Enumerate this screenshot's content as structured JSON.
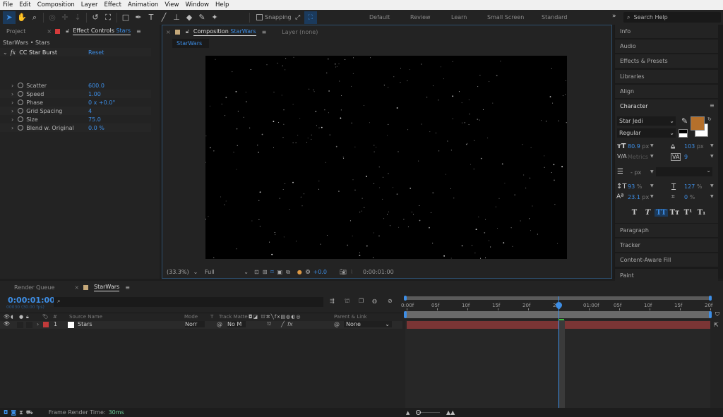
{
  "menu": [
    "File",
    "Edit",
    "Composition",
    "Layer",
    "Effect",
    "Animation",
    "View",
    "Window",
    "Help"
  ],
  "toolbar": {
    "tools": [
      {
        "name": "selection-tool-icon",
        "glyph": "➤",
        "active": true
      },
      {
        "name": "hand-tool-icon",
        "glyph": "✋"
      },
      {
        "name": "zoom-tool-icon",
        "glyph": "⌕"
      },
      {
        "name": "orbit-camera-icon",
        "glyph": "◎",
        "dim": true
      },
      {
        "name": "pan-camera-icon",
        "glyph": "✛",
        "dim": true
      },
      {
        "name": "dolly-camera-icon",
        "glyph": "⇣",
        "dim": true
      },
      {
        "name": "rotation-tool-icon",
        "glyph": "↺"
      },
      {
        "name": "pan-behind-tool-icon",
        "glyph": "⛶"
      },
      {
        "name": "rectangle-tool-icon",
        "glyph": "□"
      },
      {
        "name": "pen-tool-icon",
        "glyph": "✒"
      },
      {
        "name": "type-tool-icon",
        "glyph": "T"
      },
      {
        "name": "brush-tool-icon",
        "glyph": "╱"
      },
      {
        "name": "clone-stamp-tool-icon",
        "glyph": "⊥"
      },
      {
        "name": "eraser-tool-icon",
        "glyph": "◆"
      },
      {
        "name": "roto-brush-tool-icon",
        "glyph": "✎"
      },
      {
        "name": "puppet-pin-tool-icon",
        "glyph": "✦"
      }
    ],
    "snapping_label": "Snapping",
    "workspaces": [
      "Default",
      "Review",
      "Learn",
      "Small Screen",
      "Standard"
    ],
    "search_placeholder": "Search Help"
  },
  "effect_controls": {
    "project_tab": "Project",
    "tab_label": "Effect Controls",
    "tab_target": "Stars",
    "breadcrumb": "StarWars • Stars",
    "effect_name": "CC Star Burst",
    "reset_label": "Reset",
    "params": [
      {
        "label": "Scatter",
        "value": "600.0"
      },
      {
        "label": "Speed",
        "value": "1.00"
      },
      {
        "label": "Phase",
        "value": "0 x +0.0°"
      },
      {
        "label": "Grid Spacing",
        "value": "4"
      },
      {
        "label": "Size",
        "value": "75.0"
      },
      {
        "label": "Blend w. Original",
        "value": "0.0 %"
      }
    ]
  },
  "composition": {
    "tab_label": "Composition",
    "tab_target": "StarWars",
    "layer_tab": "Layer  (none)",
    "subtab": "StarWars",
    "zoom": "(33.3%)",
    "resolution": "Full",
    "exposure": "+0.0",
    "timecode": "0:00:01:00"
  },
  "right_panels": {
    "top": [
      "Info",
      "Audio",
      "Effects & Presets",
      "Libraries",
      "Align"
    ],
    "character_title": "Character",
    "font_family": "Star Jedi",
    "font_style": "Regular",
    "fill_color": "#b5702b",
    "font_size": "80.9",
    "font_size_unit": "px",
    "leading": "103",
    "leading_unit": "px",
    "kerning": "Metrics",
    "tracking": "9",
    "stroke_width": "-",
    "stroke_unit": "px",
    "vert_scale": "93",
    "horiz_scale": "127",
    "baseline_shift": "23.1",
    "baseline_unit": "px",
    "tsume": "0",
    "pct": "%",
    "style_buttons": [
      "T",
      "T",
      "TT",
      "Tт",
      "T¹",
      "T₁"
    ],
    "bottom": [
      "Paragraph",
      "Tracker",
      "Content-Aware Fill",
      "Paint"
    ]
  },
  "timeline": {
    "render_queue_tab": "Render Queue",
    "comp_tab": "StarWars",
    "current_time": "0:00:01:00",
    "frame_info": "00030 (30.00 fps)",
    "columns": {
      "num": "#",
      "source": "Source Name",
      "mode": "Mode",
      "t": "T",
      "track_matte": "Track Matte",
      "parent": "Parent & Link"
    },
    "layers": [
      {
        "num": "1",
        "name": "Stars",
        "mode": "Norr",
        "matte": "No M",
        "parent": "None",
        "label_color": "#c13a3a"
      }
    ],
    "ruler_ticks": [
      "0:00f",
      "05f",
      "10f",
      "15f",
      "20f",
      "25f",
      "01:00f",
      "05f",
      "10f",
      "15f",
      "20f"
    ],
    "playhead_fraction": 0.5,
    "layer_bar_color": "#7a3535"
  },
  "status": {
    "frame_render_label": "Frame Render Time:",
    "frame_render_value": "30ms"
  }
}
